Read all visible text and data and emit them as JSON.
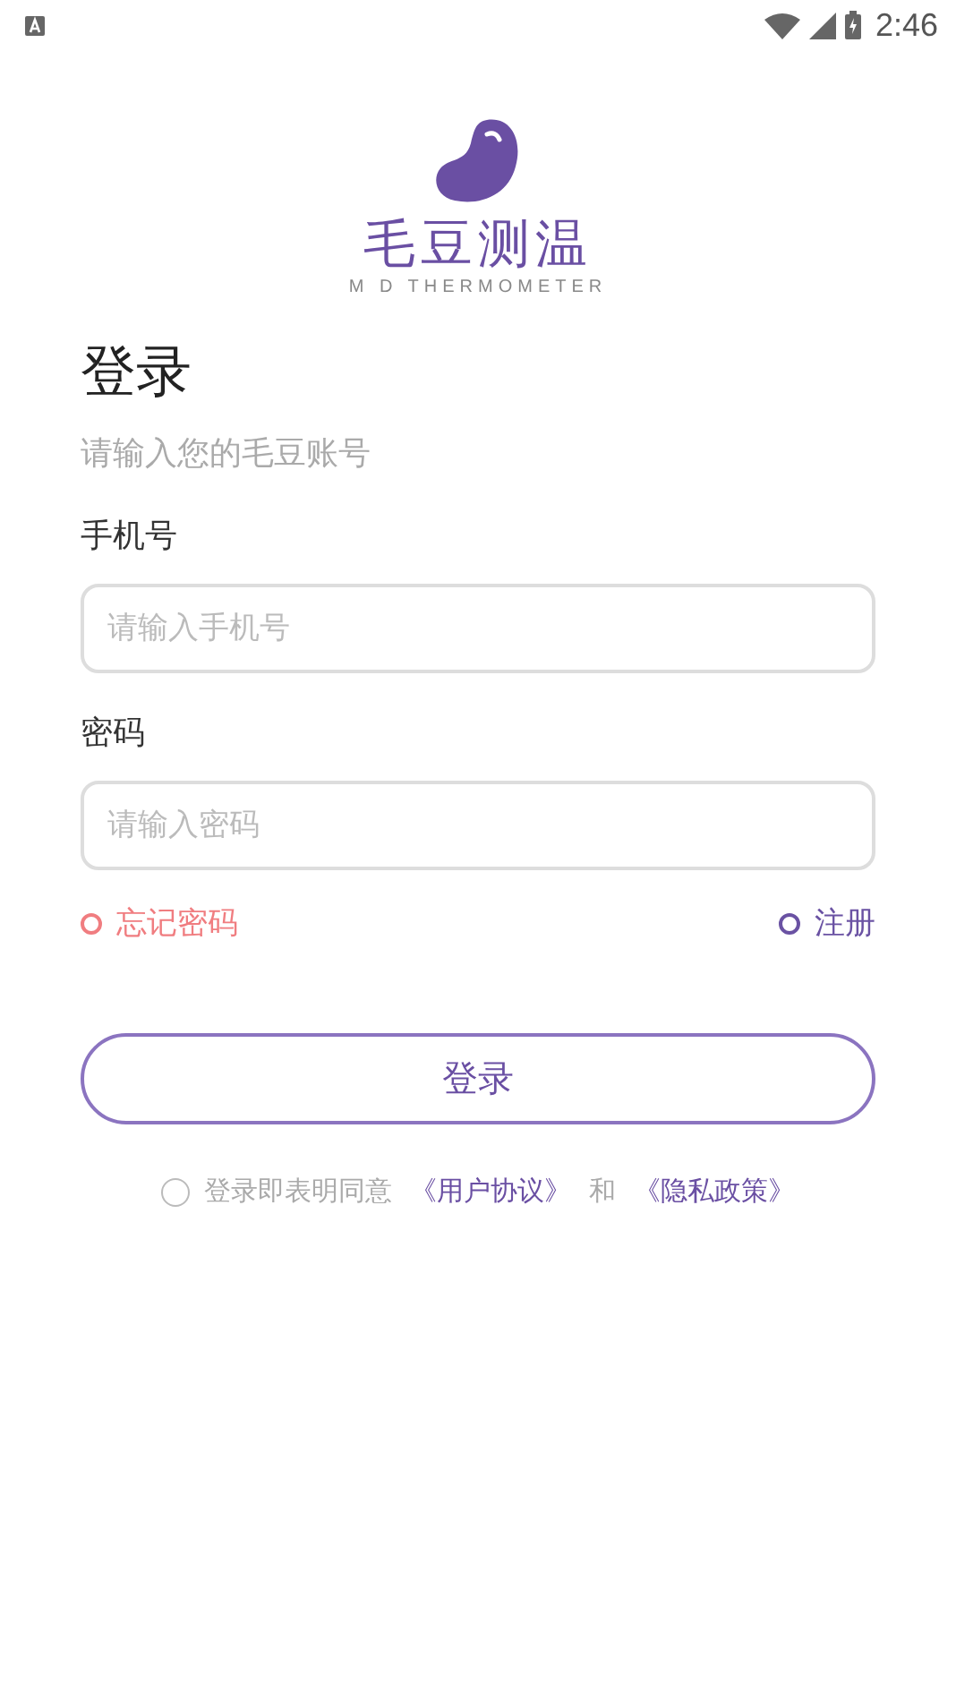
{
  "status_bar": {
    "time": "2:46"
  },
  "logo": {
    "name": "毛豆测温",
    "subtitle": "M D THERMOMETER"
  },
  "title": "登录",
  "subtitle": "请输入您的毛豆账号",
  "fields": [
    {
      "label": "手机号",
      "placeholder": "请输入手机号"
    },
    {
      "label": "密码",
      "placeholder": "请输入密码"
    }
  ],
  "links": [
    {
      "label": "忘记密码",
      "color": "#f07d80"
    },
    {
      "label": "注册",
      "color": "#6a52a3"
    }
  ],
  "login_button": "登录",
  "agreement": {
    "checked": false,
    "text": "登录即表明同意",
    "terms": "《用户协议》",
    "and": "和",
    "privacy": "《隐私政策》"
  }
}
